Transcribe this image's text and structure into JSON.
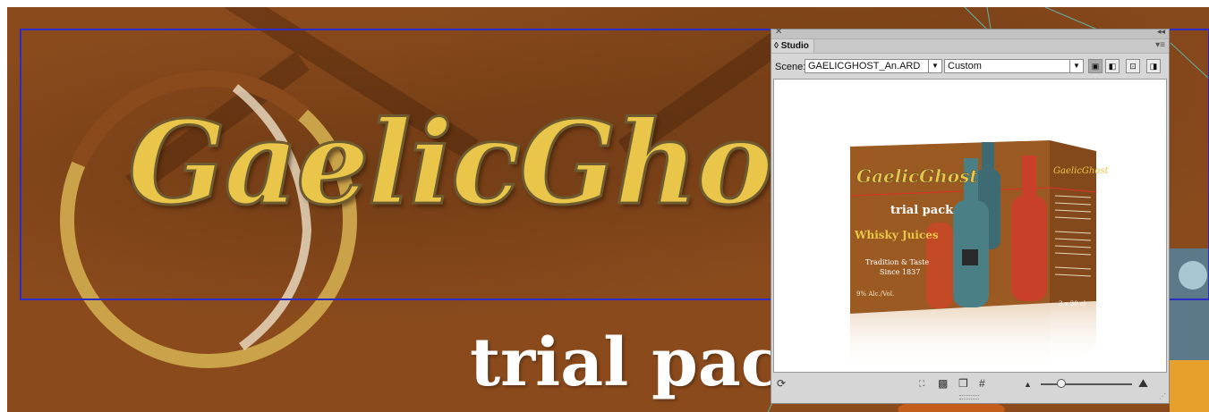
{
  "artboard": {
    "logo_text": "GaelicGhost",
    "tagline": "trial pack"
  },
  "studio": {
    "tab_label": "Studio",
    "scene_label": "Scene:",
    "scene_file": "GAELICGHOST_An.ARD",
    "view_preset": "Custom",
    "view_buttons": [
      "front-view-icon",
      "side-view-icon",
      "top-view-icon",
      "back-view-icon"
    ],
    "preview": {
      "brand": "GaelicGhost",
      "tagline": "trial pack",
      "product": "Whisky Juices",
      "slogan_1": "Tradition & Taste",
      "slogan_2": "Since 1837",
      "abv": "9% Alc./Vol.",
      "quantity": "3 x 20 cl",
      "side_brand": "GaelicGhost"
    },
    "bottom_tools": [
      "refresh-icon",
      "fit-view-icon",
      "checkerboard-icon",
      "cube-icon",
      "grid-icon"
    ],
    "zoom_level": 0.22
  },
  "colors": {
    "canvas_brown": "#8a4a1c",
    "logo_gold": "#e9c649",
    "selection_blue": "#2c2cc8",
    "guide_teal": "#5fb2a4"
  }
}
